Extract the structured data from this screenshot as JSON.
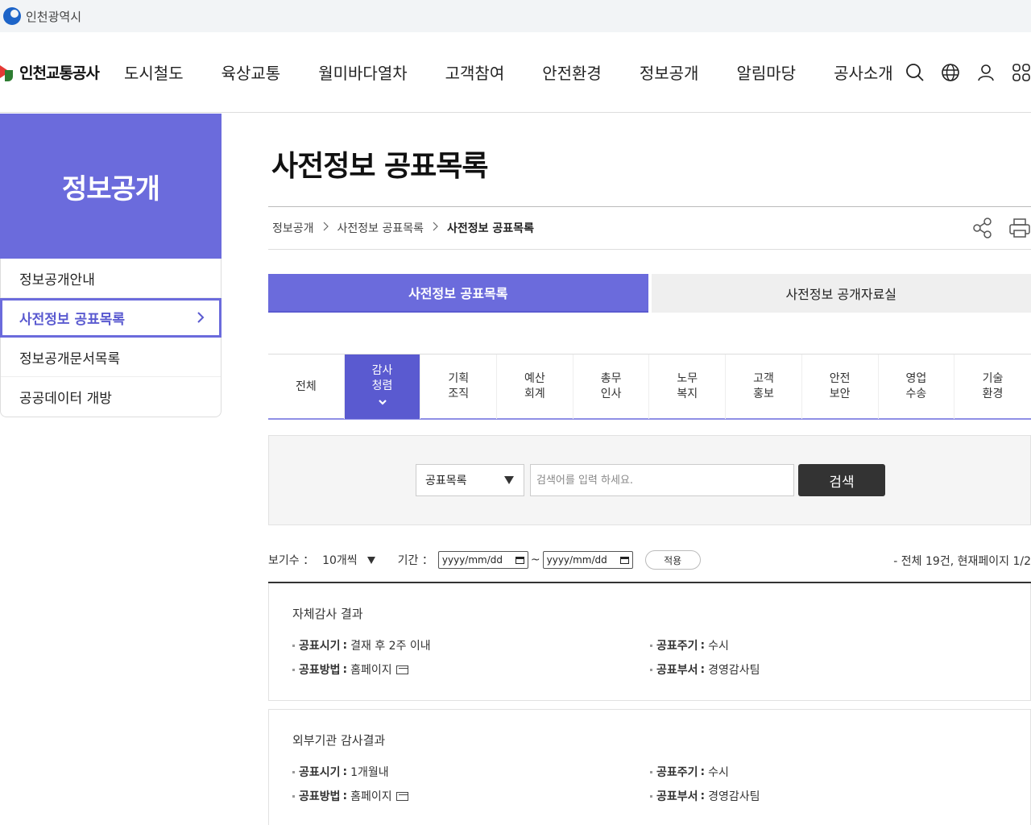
{
  "topbar": {
    "city_name": "인천광역시"
  },
  "gnb": {
    "brand": "인천교통공사",
    "menu": [
      "도시철도",
      "육상교통",
      "월미바다열차",
      "고객참여",
      "안전환경",
      "정보공개",
      "알림마당",
      "공사소개"
    ],
    "icons": [
      "search-icon",
      "globe-icon",
      "user-icon",
      "sitemap-icon"
    ]
  },
  "lnb": {
    "title": "정보공개",
    "items": [
      "정보공개안내",
      "사전정보 공표목록",
      "정보공개문서목록",
      "공공데이터 개방"
    ]
  },
  "page": {
    "title": "사전정보 공표목록"
  },
  "breadcrumb": [
    "정보공개",
    "사전정보 공표목록",
    "사전정보 공표목록"
  ],
  "tabs": [
    "사전정보 공표목록",
    "사전정보 공개자료실"
  ],
  "categories": [
    {
      "l1": "전체",
      "l2": ""
    },
    {
      "l1": "감사",
      "l2": "청렴"
    },
    {
      "l1": "기획",
      "l2": "조직"
    },
    {
      "l1": "예산",
      "l2": "회계"
    },
    {
      "l1": "총무",
      "l2": "인사"
    },
    {
      "l1": "노무",
      "l2": "복지"
    },
    {
      "l1": "고객",
      "l2": "홍보"
    },
    {
      "l1": "안전",
      "l2": "보안"
    },
    {
      "l1": "영업",
      "l2": "수송"
    },
    {
      "l1": "기술",
      "l2": "환경"
    }
  ],
  "search": {
    "select_value": "공표목록",
    "placeholder": "검색어를 입력 하세요.",
    "button": "검색"
  },
  "filter": {
    "view_label": "보기수 ：",
    "view_value": "10개씩",
    "period_label": "기간 ：",
    "date_from": "yyyy/mm/dd",
    "tilde": "~",
    "date_to": "yyyy/mm/dd",
    "apply": "적용",
    "summary": "- 전체 19건, 현재페이지 1/2"
  },
  "field_labels": {
    "time": "공표시기",
    "cycle": "공표주기",
    "method": "공표방법",
    "dept": "공표부서",
    "colon": ":"
  },
  "records": [
    {
      "title": "자체감사 결과",
      "time": "결재 후 2주 이내",
      "cycle": "수시",
      "method": "홈페이지",
      "dept": "경영감사팀"
    },
    {
      "title": "외부기관 감사결과",
      "time": "1개월내",
      "cycle": "수시",
      "method": "홈페이지",
      "dept": "경영감사팀"
    }
  ],
  "colors": {
    "accent": "#6b6bdc",
    "accent_dark": "#5a5ad0",
    "button_dark": "#333333"
  }
}
